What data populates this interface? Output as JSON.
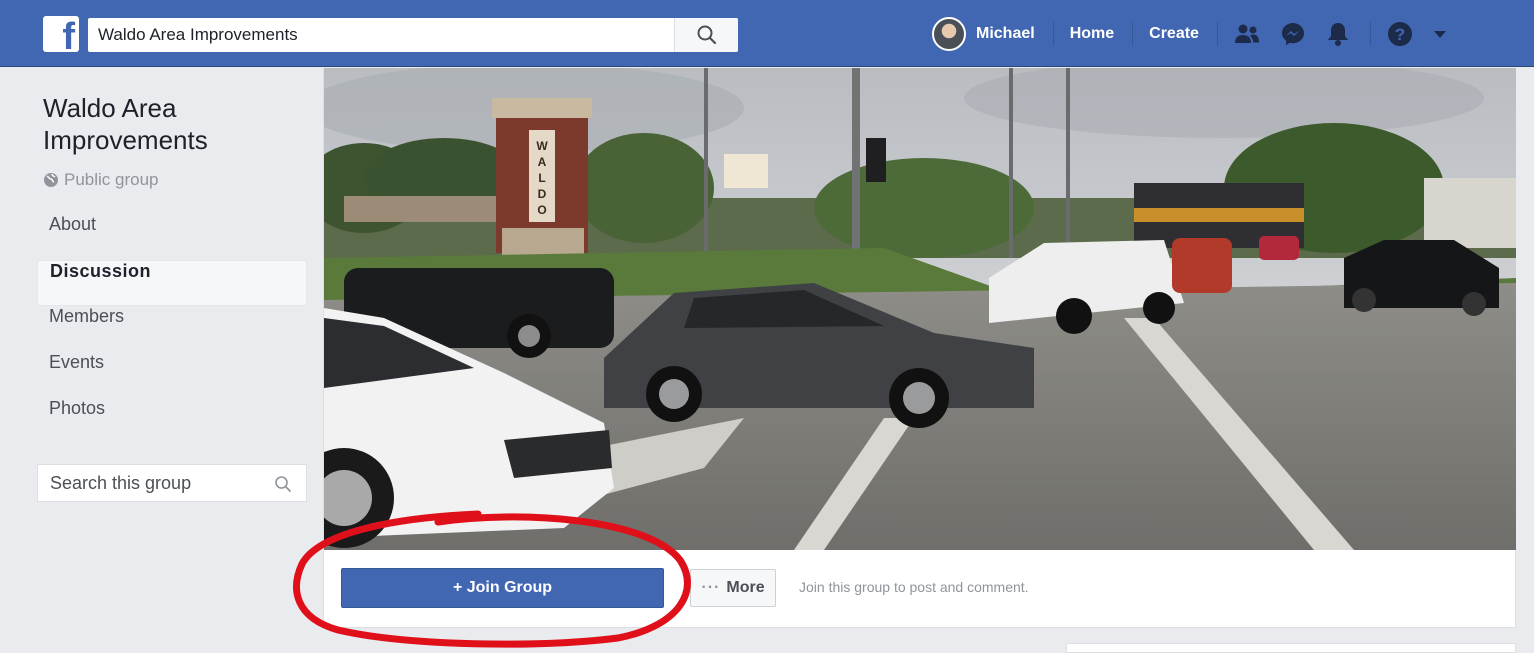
{
  "topbar": {
    "search_value": "Waldo Area Improvements",
    "user_name": "Michael",
    "home_label": "Home",
    "create_label": "Create",
    "icons": [
      "friends-icon",
      "messenger-icon",
      "notifications-icon",
      "help-icon",
      "caret-down-icon"
    ],
    "brand_color": "#4267b2"
  },
  "group": {
    "title": "Waldo Area Improvements",
    "type": "Public group"
  },
  "sidebar": {
    "items": [
      {
        "label": "About",
        "active": false
      },
      {
        "label": "Discussion",
        "active": true
      },
      {
        "label": "Members",
        "active": false
      },
      {
        "label": "Events",
        "active": false
      },
      {
        "label": "Photos",
        "active": false
      }
    ],
    "search_placeholder": "Search this group"
  },
  "cover": {
    "sign_text": "WALDO"
  },
  "actions": {
    "join_label": "+ Join Group",
    "more_label": "More",
    "hint": "Join this group to post and comment."
  },
  "annotation": {
    "color": "#e0101a",
    "shape": "hand-drawn ellipse around join button"
  }
}
